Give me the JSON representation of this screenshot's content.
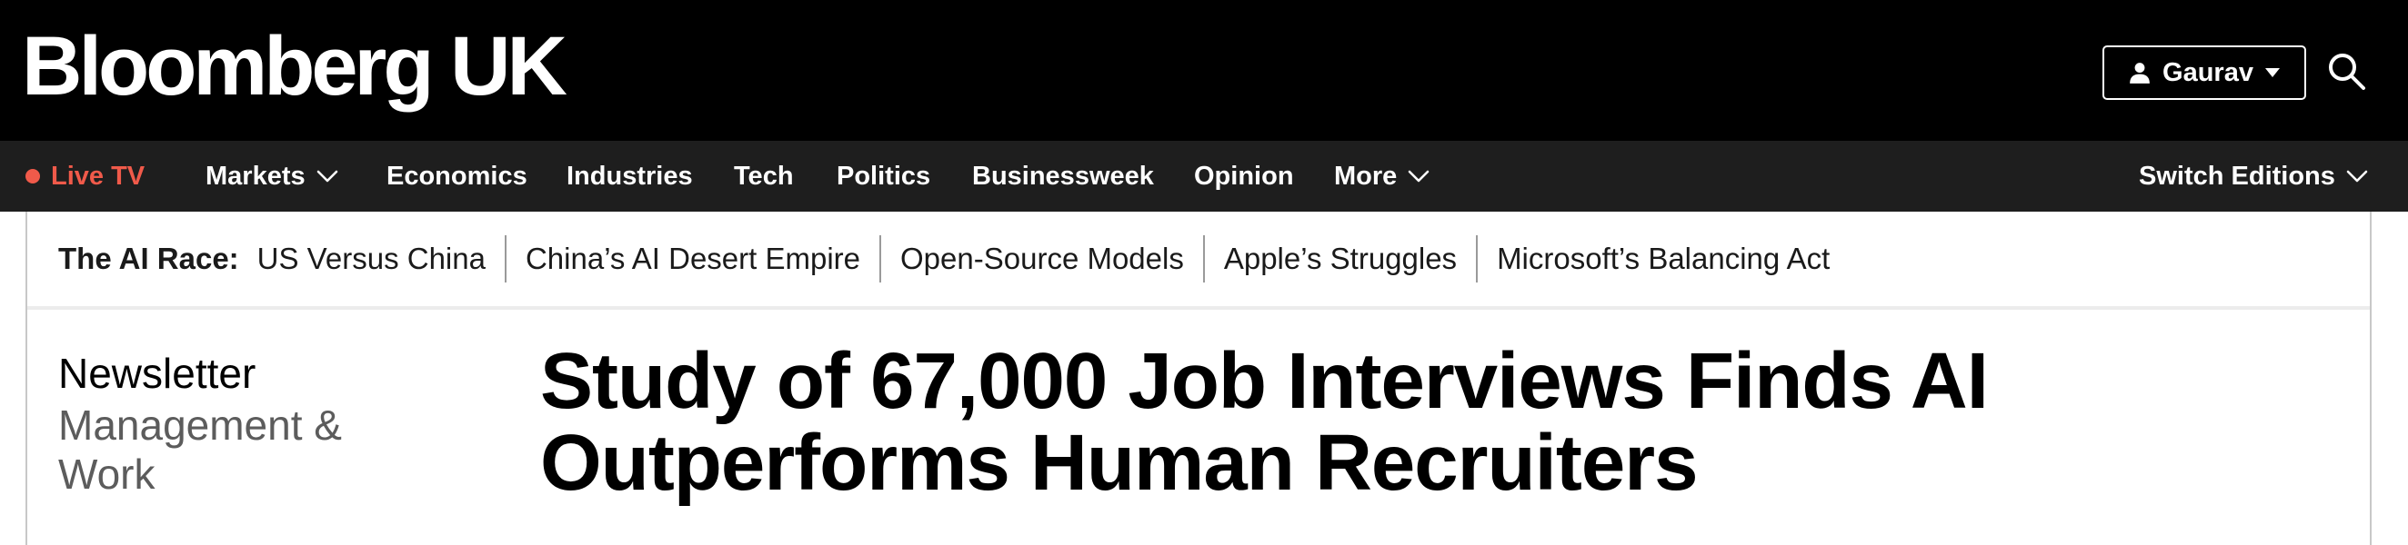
{
  "header": {
    "brand": "Bloomberg UK",
    "user_name": "Gaurav",
    "icons": {
      "user": "person-icon",
      "user_menu": "caret-down-icon",
      "search": "search-icon"
    }
  },
  "nav": {
    "live_tv": "Live TV",
    "items": [
      "Markets",
      "Economics",
      "Industries",
      "Tech",
      "Politics",
      "Businessweek",
      "Opinion",
      "More"
    ],
    "switch_editions": "Switch Editions",
    "colors": {
      "live": "#f05a4a",
      "nav_bg": "#1e1e1e",
      "masthead_bg": "#000000"
    }
  },
  "subnav": {
    "label": "The AI Race:",
    "links": [
      "US Versus China",
      "China’s AI Desert Empire",
      "Open-Source Models",
      "Apple’s Struggles",
      "Microsoft’s Balancing Act"
    ]
  },
  "article": {
    "kicker": "Newsletter",
    "section": "Management & Work",
    "headline": "Study of 67,000 Job Interviews Finds AI Outperforms Human Recruiters"
  }
}
